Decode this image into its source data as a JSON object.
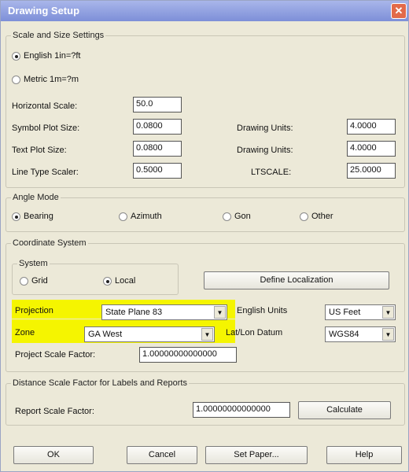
{
  "window": {
    "title": "Drawing Setup",
    "close_glyph": "✕"
  },
  "scale_section": {
    "legend": "Scale and Size Settings",
    "radio_english": "English 1in=?ft",
    "radio_metric": "Metric 1m=?m",
    "horizontal_scale_label": "Horizontal Scale:",
    "horizontal_scale_value": "50.0",
    "symbol_plot_size_label": "Symbol Plot Size:",
    "symbol_plot_size_value": "0.0800",
    "symbol_drawing_units_label": "Drawing Units:",
    "symbol_drawing_units_value": "4.0000",
    "text_plot_size_label": "Text Plot Size:",
    "text_plot_size_value": "0.0800",
    "text_drawing_units_label": "Drawing Units:",
    "text_drawing_units_value": "4.0000",
    "line_type_scaler_label": "Line Type Scaler:",
    "line_type_scaler_value": "0.5000",
    "ltscale_label": "LTSCALE:",
    "ltscale_value": "25.0000"
  },
  "angle_section": {
    "legend": "Angle Mode",
    "options": [
      "Bearing",
      "Azimuth",
      "Gon",
      "Other"
    ],
    "selected": "Bearing"
  },
  "coordinate_section": {
    "legend": "Coordinate System",
    "system_legend": "System",
    "system_options": [
      "Grid",
      "Local"
    ],
    "system_selected": "Local",
    "define_localization_button": "Define Localization",
    "projection_label": "Projection",
    "projection_value": "State Plane 83",
    "zone_label": "Zone",
    "zone_value": "GA West",
    "english_units_label": "English Units",
    "english_units_value": "US Feet",
    "latlon_datum_label": "Lat/Lon Datum",
    "latlon_datum_value": "WGS84",
    "project_scale_factor_label": "Project Scale Factor:",
    "project_scale_factor_value": "1.00000000000000",
    "highlight_color": "#f5f500"
  },
  "distance_section": {
    "legend": "Distance Scale Factor for Labels and Reports",
    "report_scale_factor_label": "Report Scale Factor:",
    "report_scale_factor_value": "1.00000000000000",
    "calculate_button": "Calculate"
  },
  "buttons": {
    "ok": "OK",
    "cancel": "Cancel",
    "set_paper": "Set Paper...",
    "help": "Help"
  }
}
